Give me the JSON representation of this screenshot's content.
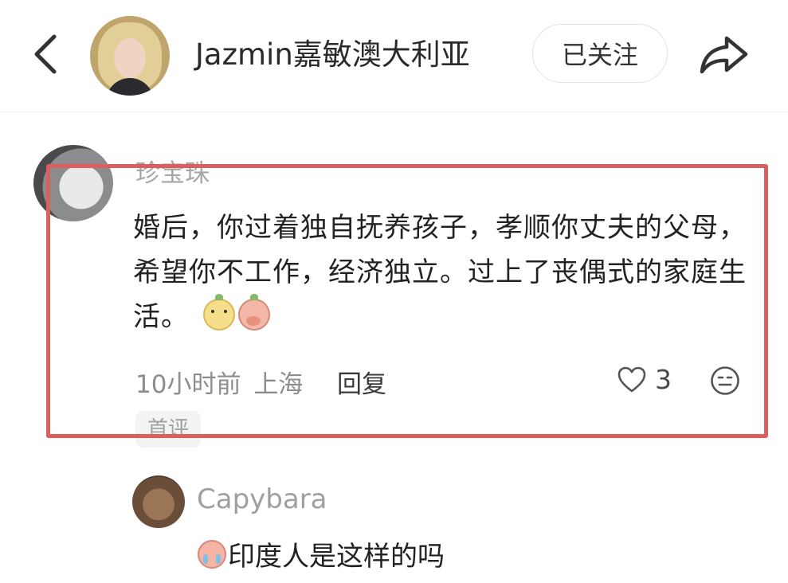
{
  "header": {
    "account_name": "Jazmin嘉敏澳大利亚",
    "follow_label": "已关注",
    "back_icon": "chevron-left-icon",
    "share_icon": "share-arrow-icon"
  },
  "comment": {
    "author": "珍宝珠",
    "text": "婚后，你过着独自抚养孩子，孝顺你丈夫的父母，希望你不工作，经济独立。过上了丧偶式的家庭生活。",
    "emojis": [
      "yellow-face-emoji",
      "pink-covering-mouth-emoji"
    ],
    "time": "10小时前",
    "location": "上海",
    "reply_label": "回复",
    "like_count": "3",
    "badge": "首评",
    "highlight_color": "#d9605e"
  },
  "reply": {
    "author": "Capybara",
    "emoji": "crying-face-emoji",
    "text": "印度人是这样的吗"
  }
}
